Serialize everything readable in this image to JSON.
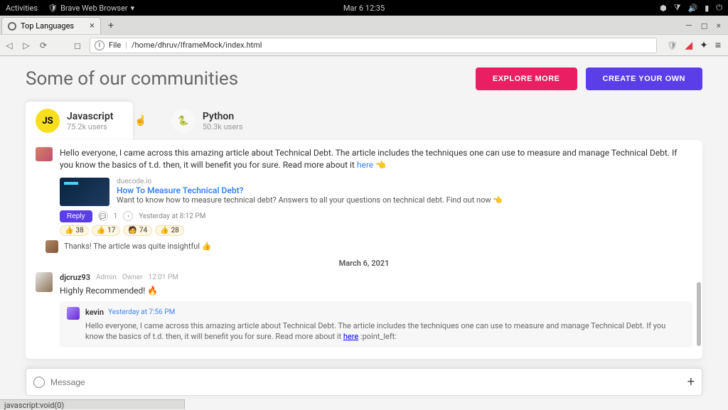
{
  "system": {
    "activities": "Activities",
    "app": "Brave Web Browser",
    "clock": "Mar 6  12:35"
  },
  "browser": {
    "tab_title": "Top Languages",
    "url_label": "File",
    "url_path": "/home/dhruv/IframeMock/index.html",
    "status": "javascript:void(0)"
  },
  "header": {
    "title": "Some of our communities",
    "explore": "EXPLORE MORE",
    "create": "CREATE YOUR OWN"
  },
  "communities": [
    {
      "name": "Javascript",
      "users": "75.2k users",
      "icon": "JS"
    },
    {
      "name": "Python",
      "users": "50.3k users",
      "icon": "🐍"
    }
  ],
  "post1": {
    "text_a": "Hello everyone, I came across this amazing article about Technical Debt. The article includes the techniques one can use to measure and manage Technical Debt. If you know the basics of t.d. then, it will benefit you for sure. Read more about it ",
    "link_word": "here",
    "emoji": "👈",
    "card": {
      "source": "duecode.io",
      "title": "How To Measure Technical Debt?",
      "desc": "Want to know how to measure technical debt? Answers to all your questions on technical debt. Find out now 👈"
    },
    "actions": {
      "reply": "Reply",
      "replies": "1",
      "time": "Yesterday at 8:12 PM"
    },
    "reactions": [
      {
        "emoji": "👍",
        "count": "38"
      },
      {
        "emoji": "👍",
        "count": "17"
      },
      {
        "emoji": "🧑",
        "count": "74"
      },
      {
        "emoji": "👍",
        "count": "28"
      }
    ],
    "reply1": {
      "text": "Thanks! The article was quite insightful 👍"
    }
  },
  "date_sep": "March 6, 2021",
  "post2": {
    "user": "djcruz93",
    "badges": [
      "Admin",
      "Owner"
    ],
    "time": "12:01 PM",
    "text": "Highly Recommended! 🔥",
    "quote": {
      "user": "kevin",
      "time": "Yesterday at 7:56 PM",
      "body_a": "Hello everyone, I came across this amazing article about Technical Debt. The article includes the techniques one can use to measure and manage Technical Debt. If you know the basics of t.d. then, it will benefit you for sure. Read more about it ",
      "link_word": "here",
      "tail": " :point_left:"
    }
  },
  "composer": {
    "placeholder": "Message"
  }
}
